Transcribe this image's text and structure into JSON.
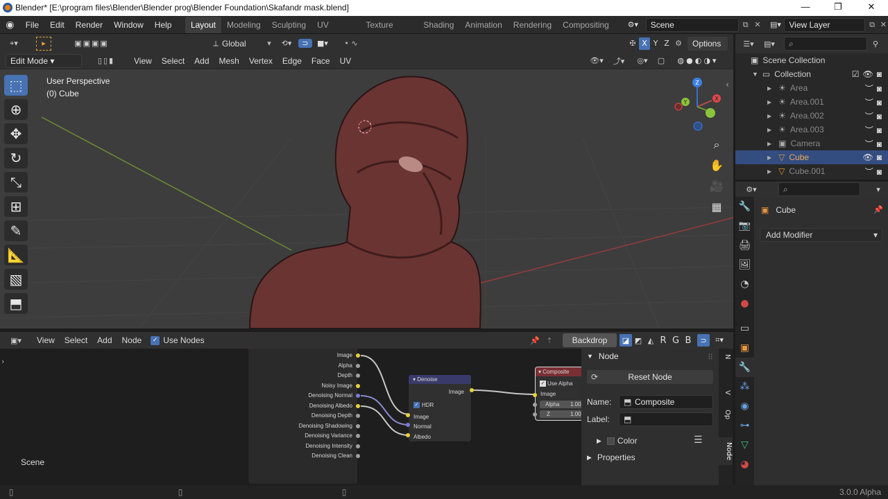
{
  "window": {
    "title": "Blender* [E:\\program files\\Blender\\Blender prog\\Blender Foundation\\Skafandr mask.blend]"
  },
  "menu": [
    "File",
    "Edit",
    "Render",
    "Window",
    "Help"
  ],
  "workspaces": [
    "Layout",
    "Modeling",
    "Sculpting",
    "UV Editing",
    "Texture Paint",
    "Shading",
    "Animation",
    "Rendering",
    "Compositing"
  ],
  "active_workspace": "Layout",
  "scene_field": "Scene",
  "view_layer_field": "View Layer",
  "viewport": {
    "mode": "Edit Mode",
    "orientation": "Global",
    "menus": [
      "View",
      "Select",
      "Add",
      "Mesh",
      "Vertex",
      "Edge",
      "Face",
      "UV"
    ],
    "options_label": "Options",
    "axis_x": "X",
    "axis_y": "Y",
    "axis_z": "Z",
    "perspective_label": "User Perspective",
    "object_label": "(0) Cube",
    "gizmo": {
      "x": "X",
      "y": "Y",
      "z": "Z"
    }
  },
  "node_editor": {
    "menus": [
      "View",
      "Select",
      "Add",
      "Node"
    ],
    "use_nodes_label": "Use Nodes",
    "backdrop_label": "Backdrop",
    "channel_r": "R",
    "channel_g": "G",
    "channel_b": "B",
    "scene_label": "Scene",
    "render_layer_outputs": [
      "Image",
      "Alpha",
      "Depth",
      "Noisy Image",
      "Denoising Normal",
      "Denoising Albedo",
      "Denoising Depth",
      "Denoising Shadowing",
      "Denoising Variance",
      "Denoising Intensity",
      "Denoising Clean"
    ],
    "denoise_node": {
      "title": "Denoise",
      "output": "Image",
      "hdr_label": "HDR",
      "inputs": [
        "Image",
        "Normal",
        "Albedo"
      ]
    },
    "composite_node": {
      "title": "Composite",
      "use_alpha_label": "Use Alpha",
      "inputs": [
        "Image"
      ],
      "alpha_label": "Alpha",
      "alpha_value": "1.00",
      "z_label": "Z",
      "z_value": "1.00"
    }
  },
  "node_sidebar": {
    "section": "Node",
    "reset_label": "Reset Node",
    "name_label": "Name:",
    "name_value": "Composite",
    "label_label": "Label:",
    "label_value": "",
    "color_label": "Color",
    "properties_label": "Properties",
    "tabs": [
      "N",
      "V",
      "Op",
      "Node"
    ]
  },
  "outliner": {
    "root": "Scene Collection",
    "collection": "Collection",
    "items": [
      "Area",
      "Area.001",
      "Area.002",
      "Area.003",
      "Camera",
      "Cube",
      "Cube.001"
    ],
    "selected": "Cube"
  },
  "properties": {
    "object_name": "Cube",
    "add_modifier_label": "Add Modifier"
  },
  "status": {
    "version": "3.0.0 Alpha"
  },
  "colors": {
    "accent": "#4772b3",
    "selected_text": "#f0a85a",
    "viewport_bg": "#3d3d3d"
  }
}
